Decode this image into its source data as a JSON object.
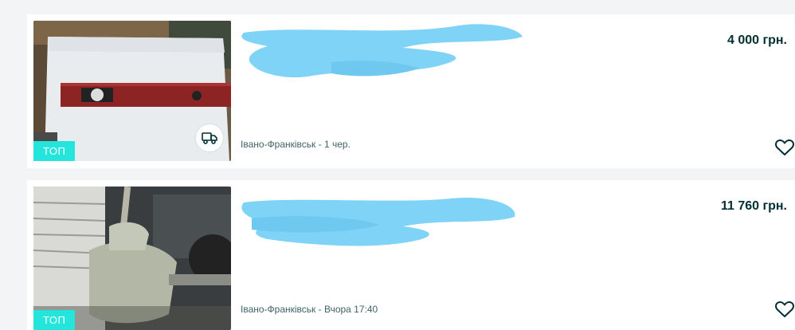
{
  "listings": [
    {
      "badge": "ТОП",
      "price": "4 000 грн.",
      "location": "Івано-Франківськ - 1 чер.",
      "has_delivery": true,
      "favorite_icon": "heart-outline-icon",
      "delivery_icon": "truck-icon"
    },
    {
      "badge": "ТОП",
      "price": "11 760 грн.",
      "location": "Івано-Франківськ - Вчора 17:40",
      "has_delivery": false,
      "favorite_icon": "heart-outline-icon"
    }
  ],
  "colors": {
    "badge_bg": "#23e5db",
    "price_text": "#002f34",
    "location_text": "#406367",
    "redaction": "#7ed3f7",
    "page_bg": "#f2f4f5"
  }
}
